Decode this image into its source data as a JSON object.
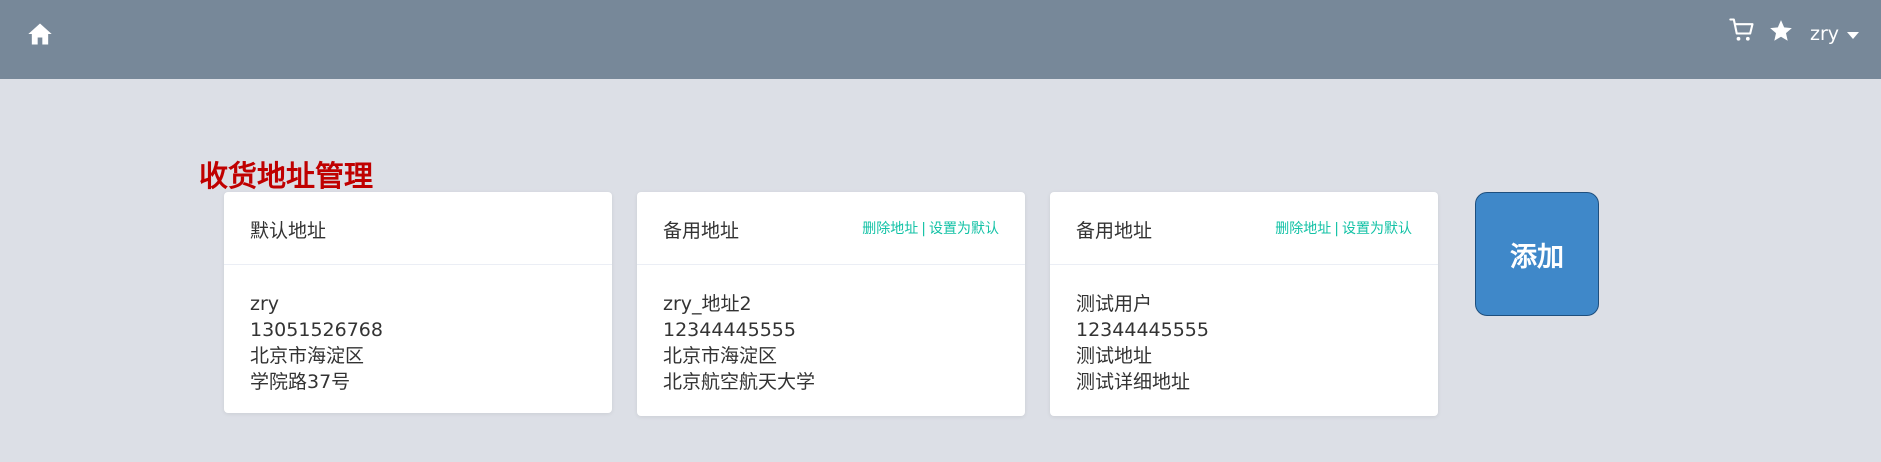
{
  "header": {
    "username": "zry"
  },
  "page": {
    "title": "收货地址管理"
  },
  "addresses": [
    {
      "type": "默认地址",
      "name": "zry",
      "phone": "13051526768",
      "region": "北京市海淀区",
      "detail": "学院路37号"
    },
    {
      "type": "备用地址",
      "delete_label": "删除地址",
      "separator": "|",
      "set_default_label": "设置为默认",
      "name": "zry_地址2",
      "phone": "12344445555",
      "region": "北京市海淀区",
      "detail": "北京航空航天大学"
    },
    {
      "type": "备用地址",
      "delete_label": "删除地址",
      "separator": "|",
      "set_default_label": "设置为默认",
      "name": "测试用户",
      "phone": "12344445555",
      "region": "测试地址",
      "detail": "测试详细地址"
    }
  ],
  "add_button": {
    "label": "添加"
  },
  "icons": [
    "home-icon",
    "cart-icon",
    "star-icon",
    "chevron-down-icon"
  ],
  "colors": {
    "header_bg": "#778899",
    "page_bg": "#dcdfe6",
    "title": "#c00000",
    "link": "#13c2a6",
    "add_button": "#3f88c9"
  }
}
